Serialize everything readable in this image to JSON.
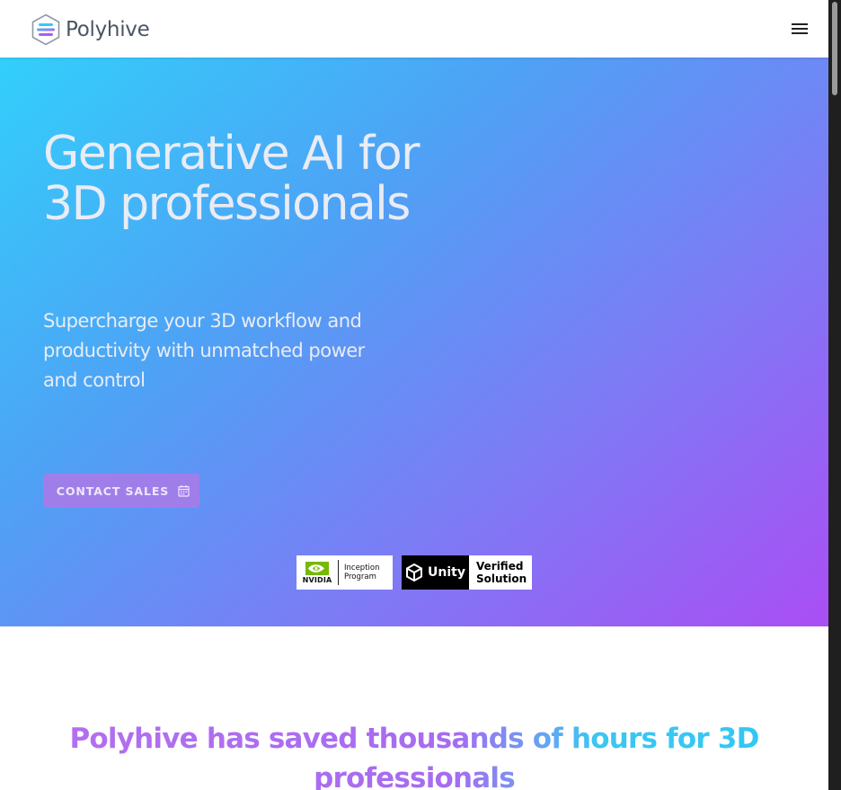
{
  "header": {
    "brand": "Polyhive",
    "menu_icon": "hamburger-menu-icon"
  },
  "hero": {
    "title": "Generative AI for 3D professionals",
    "subtitle": "Supercharge your 3D workflow and productivity with unmatched power and control",
    "cta_label": "CONTACT SALES",
    "cta_icon": "calendar-icon",
    "badges": {
      "nvidia": {
        "brand": "NVIDIA",
        "line1": "Inception",
        "line2": "Program"
      },
      "unity": {
        "brand": "Unity",
        "line1": "Verified",
        "line2": "Solution"
      }
    },
    "colors": {
      "gradient_start": "#32cffb",
      "gradient_end": "#aa4ef4",
      "cta_background": "#a07ee9"
    }
  },
  "stats": {
    "heading": "Polyhive has saved thousands of hours for 3D professionals"
  }
}
